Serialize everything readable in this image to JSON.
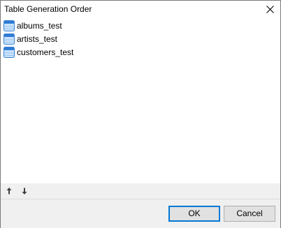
{
  "window": {
    "title": "Table Generation Order"
  },
  "tables": [
    {
      "label": "albums_test"
    },
    {
      "label": "artists_test"
    },
    {
      "label": "customers_test"
    }
  ],
  "buttons": {
    "ok_label": "OK",
    "cancel_label": "Cancel"
  },
  "icons": {
    "close": "close-icon",
    "table": "table-icon",
    "move_up": "arrow-up-icon",
    "move_down": "arrow-down-icon"
  },
  "colors": {
    "accent": "#0078d7",
    "table_icon_header": "#2f7bd6",
    "table_icon_body": "#c9e2fb",
    "footer_bg": "#f0f0f0"
  }
}
